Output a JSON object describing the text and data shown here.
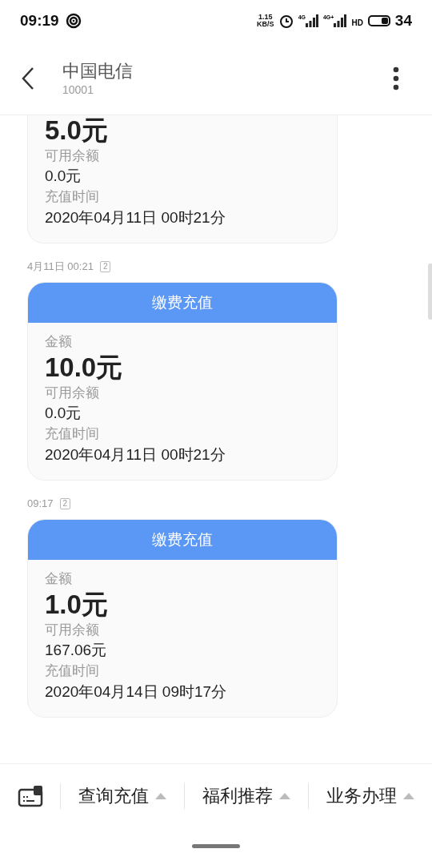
{
  "status_bar": {
    "time": "09:19",
    "speed_value": "1.15",
    "speed_unit": "KB/S",
    "network_1": "4G",
    "network_2": "4G+",
    "hd": "HD",
    "battery": "34"
  },
  "header": {
    "title": "中国电信",
    "subtitle": "10001"
  },
  "messages": [
    {
      "amount": "5.0元",
      "balance_label": "可用余额",
      "balance": "0.0元",
      "time_label": "充值时间",
      "time": "2020年04月11日 00时21分"
    },
    {
      "timestamp": "4月11日 00:21",
      "sim": "2",
      "header": "缴费充值",
      "amount_label": "金额",
      "amount": "10.0元",
      "balance_label": "可用余额",
      "balance": "0.0元",
      "time_label": "充值时间",
      "time": "2020年04月11日 00时21分"
    },
    {
      "timestamp": "09:17",
      "sim": "2",
      "header": "缴费充值",
      "amount_label": "金额",
      "amount": "1.0元",
      "balance_label": "可用余额",
      "balance": "167.06元",
      "time_label": "充值时间",
      "time": "2020年04月14日 09时17分"
    }
  ],
  "menu": [
    "查询充值",
    "福利推荐",
    "业务办理"
  ]
}
